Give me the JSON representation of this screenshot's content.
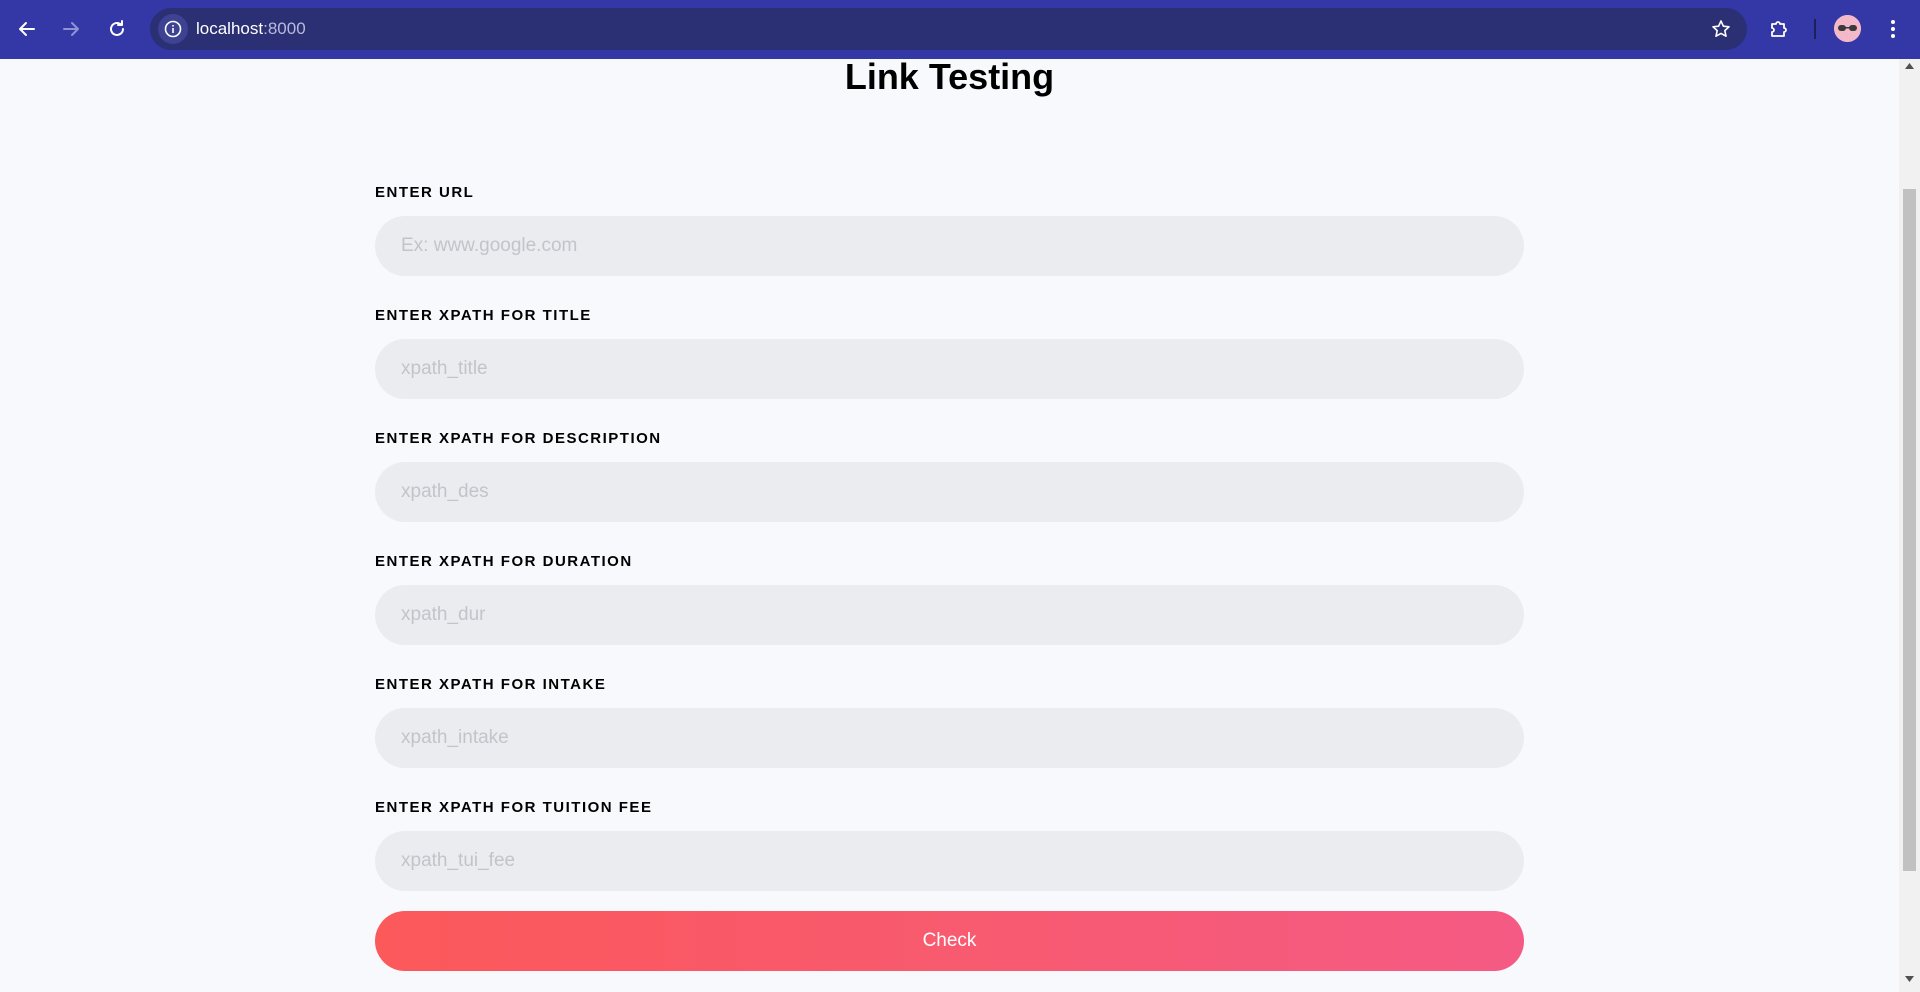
{
  "browser": {
    "url_host": "localhost",
    "url_port": ":8000",
    "icons": {
      "back": "arrow-left-icon",
      "forward": "arrow-right-icon",
      "reload": "reload-icon",
      "site_info": "info-icon",
      "bookmark": "star-icon",
      "extensions": "puzzle-icon",
      "profile": "avatar",
      "menu": "kebab-menu-icon"
    },
    "colors": {
      "toolbar": "#3438a6",
      "omnibox": "#2b2f73"
    }
  },
  "page": {
    "title": "Link Testing"
  },
  "form": {
    "fields": [
      {
        "label": "ENTER URL",
        "placeholder": "Ex: www.google.com",
        "value": ""
      },
      {
        "label": "ENTER XPATH FOR TITLE",
        "placeholder": "xpath_title",
        "value": ""
      },
      {
        "label": "ENTER XPATH FOR DESCRIPTION",
        "placeholder": "xpath_des",
        "value": ""
      },
      {
        "label": "ENTER XPATH FOR DURATION",
        "placeholder": "xpath_dur",
        "value": ""
      },
      {
        "label": "ENTER XPATH FOR INTAKE",
        "placeholder": "xpath_intake",
        "value": ""
      },
      {
        "label": "ENTER XPATH FOR TUITION FEE",
        "placeholder": "xpath_tui_fee",
        "value": ""
      }
    ],
    "submit_label": "Check",
    "colors": {
      "button_start": "#fb595a",
      "button_end": "#f55a84",
      "input_bg": "#ebecf0"
    }
  }
}
